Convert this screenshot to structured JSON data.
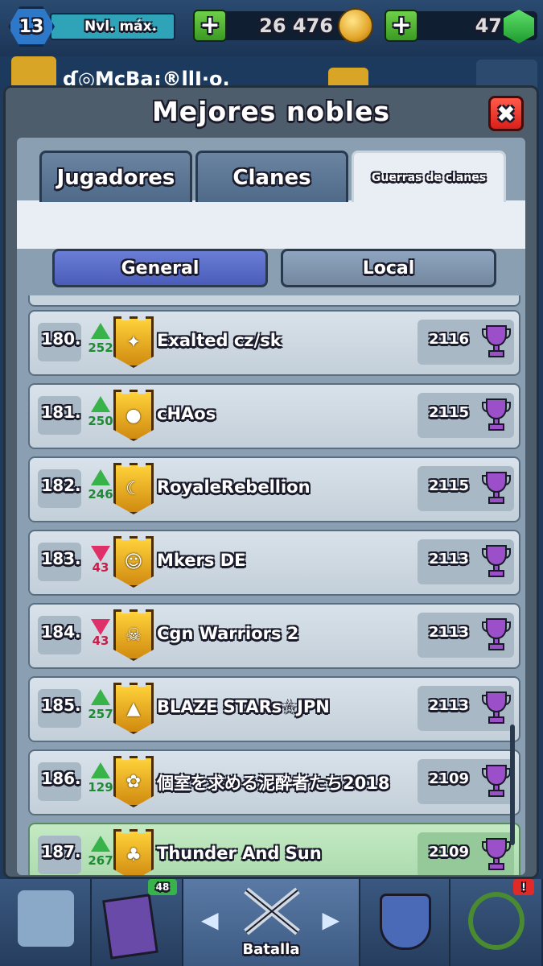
{
  "topbar": {
    "level": "13",
    "level_status": "Nvl. máx.",
    "gold": "26 476",
    "gems": "47",
    "plus_label": "+"
  },
  "profile": {
    "name": "ɗ◎McBa¡®llI·o."
  },
  "modal": {
    "title": "Mejores nobles",
    "close_label": "✖",
    "tabs": [
      {
        "label": "Jugadores",
        "active": false
      },
      {
        "label": "Clanes",
        "active": false
      },
      {
        "label": "Guerras de clanes",
        "active": true
      }
    ],
    "toggles": [
      {
        "label": "General",
        "active": true
      },
      {
        "label": "Local",
        "active": false
      }
    ]
  },
  "rows": [
    {
      "rank": "180.",
      "dir": "up",
      "change": "252",
      "name": "Exalted cz/sk",
      "badge_icon": "✦",
      "trophies": "2116"
    },
    {
      "rank": "181.",
      "dir": "up",
      "change": "250",
      "name": "cHAos",
      "badge_icon": "●",
      "trophies": "2115"
    },
    {
      "rank": "182.",
      "dir": "up",
      "change": "246",
      "name": "RoyaleRebellion",
      "badge_icon": "☾",
      "trophies": "2115"
    },
    {
      "rank": "183.",
      "dir": "down",
      "change": "43",
      "name": "Mkers DE",
      "badge_icon": "☺",
      "trophies": "2113"
    },
    {
      "rank": "184.",
      "dir": "down",
      "change": "43",
      "name": "Cgn Warriors 2",
      "badge_icon": "☠",
      "trophies": "2113"
    },
    {
      "rank": "185.",
      "dir": "up",
      "change": "257",
      "name": "BLAZE STARs☆JPN",
      "badge_icon": "▲",
      "trophies": "2113"
    },
    {
      "rank": "186.",
      "dir": "up",
      "change": "129",
      "name": "個室を求める泥酔者たち2018",
      "badge_icon": "✿",
      "trophies": "2109"
    },
    {
      "rank": "187.",
      "dir": "up",
      "change": "267",
      "name": "Thunder And Sun",
      "badge_icon": "♣",
      "trophies": "2109",
      "highlight": true
    }
  ],
  "nav": {
    "battle_label": "Batalla",
    "cards_badge": "48",
    "left_chevron": "◀",
    "right_chevron": "▶",
    "notif_badge": "!"
  },
  "colors": {
    "trophy": "#9b4fc9",
    "up": "#37b34a",
    "down": "#e0306a"
  }
}
